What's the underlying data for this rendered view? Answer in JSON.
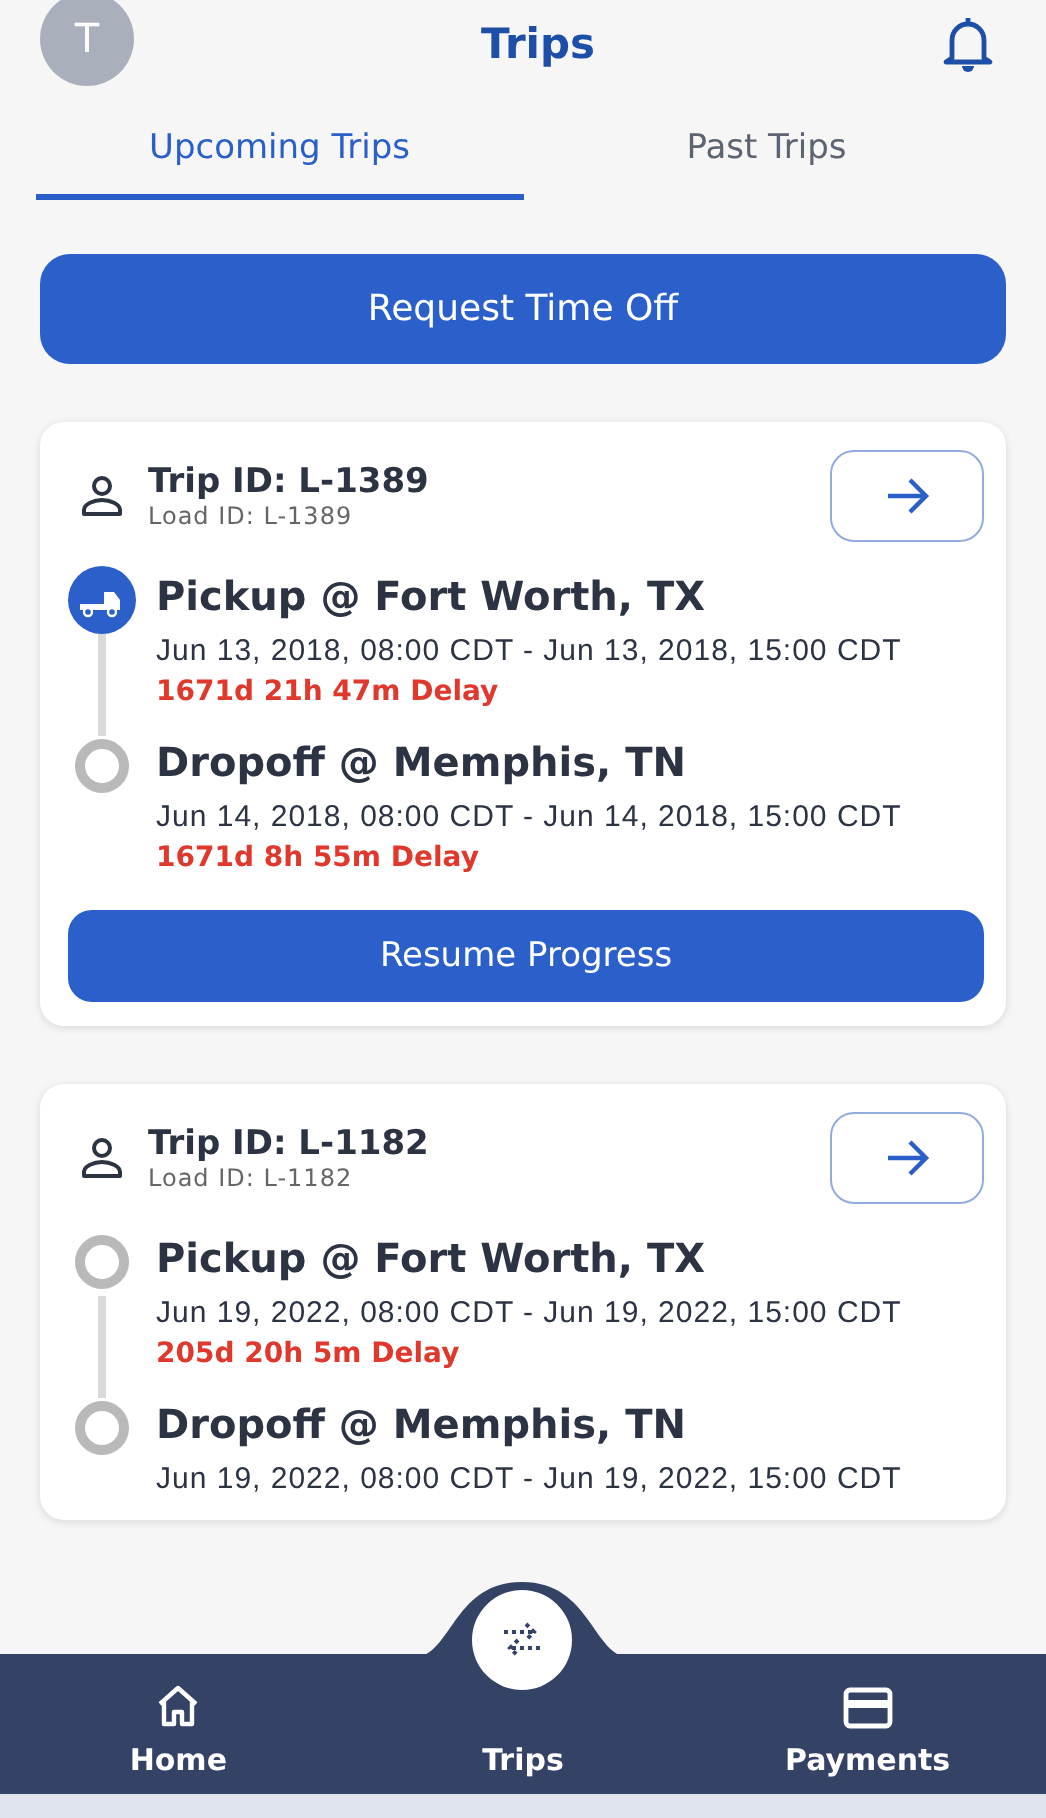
{
  "header": {
    "avatar_initial": "T",
    "title": "Trips"
  },
  "tabs": [
    {
      "label": "Upcoming Trips",
      "selected": true
    },
    {
      "label": "Past Trips",
      "selected": false
    }
  ],
  "request_button": "Request Time Off",
  "trips": [
    {
      "trip_id": "Trip ID: L-1389",
      "load_id": "Load ID: L-1389",
      "stops": [
        {
          "title": "Pickup @ Fort Worth, TX",
          "window": "Jun 13, 2018, 08:00 CDT - Jun 13, 2018, 15:00 CDT",
          "delay": "1671d 21h 47m Delay",
          "active": true
        },
        {
          "title": "Dropoff @ Memphis, TN",
          "window": "Jun 14, 2018, 08:00 CDT - Jun 14, 2018, 15:00 CDT",
          "delay": "1671d 8h 55m Delay",
          "active": false
        }
      ],
      "action": "Resume Progress"
    },
    {
      "trip_id": "Trip ID: L-1182",
      "load_id": "Load ID: L-1182",
      "stops": [
        {
          "title": "Pickup @ Fort Worth, TX",
          "window": "Jun 19, 2022, 08:00 CDT - Jun 19, 2022, 15:00 CDT",
          "delay": "205d 20h 5m Delay",
          "active": false
        },
        {
          "title": "Dropoff @ Memphis, TN",
          "window": "Jun 19, 2022, 08:00 CDT - Jun 19, 2022, 15:00 CDT",
          "active": false
        }
      ]
    }
  ],
  "nav": [
    {
      "label": "Home",
      "kind": "home",
      "selected": false
    },
    {
      "label": "Trips",
      "kind": "trips",
      "selected": true
    },
    {
      "label": "Payments",
      "kind": "payments",
      "selected": false
    }
  ]
}
